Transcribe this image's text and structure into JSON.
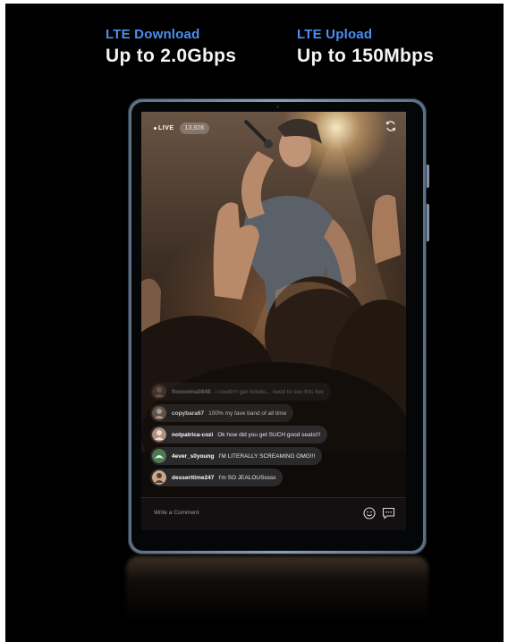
{
  "specs": [
    {
      "label": "LTE Download",
      "value": "Up to 2.0Gbps"
    },
    {
      "label": "LTE Upload",
      "value": "Up to 150Mbps"
    }
  ],
  "stream": {
    "live_label": "LIVE",
    "viewer_count": "13,928",
    "refresh_icon": "refresh-icon"
  },
  "comments": [
    {
      "user": "flooooma0848",
      "text": "i couldn't get tickets... need to see this live",
      "avatar_color": "#8a7060"
    },
    {
      "user": "copybara67",
      "text": "100% my fave band of all time",
      "avatar_color": "#7a6a62"
    },
    {
      "user": "notpatrica-cozi",
      "text": "Ok how did you get SUCH good seats!!!",
      "avatar_color": "#b09080"
    },
    {
      "user": "4ever_s0young",
      "text": "I'M LITERALLY SCREAMING OMG!!!",
      "avatar_color": "#4f7a52"
    },
    {
      "user": "desserttime247",
      "text": "I'm SO JEALOUSssss",
      "avatar_color": "#c8a888"
    }
  ],
  "input": {
    "placeholder": "Write a Comment",
    "emoji_icon": "emoji-icon",
    "chat_icon": "chat-bubble-icon"
  },
  "colors": {
    "background": "#000000",
    "accent": "#4b8ff0",
    "tablet_frame": "#8aa0b8"
  }
}
